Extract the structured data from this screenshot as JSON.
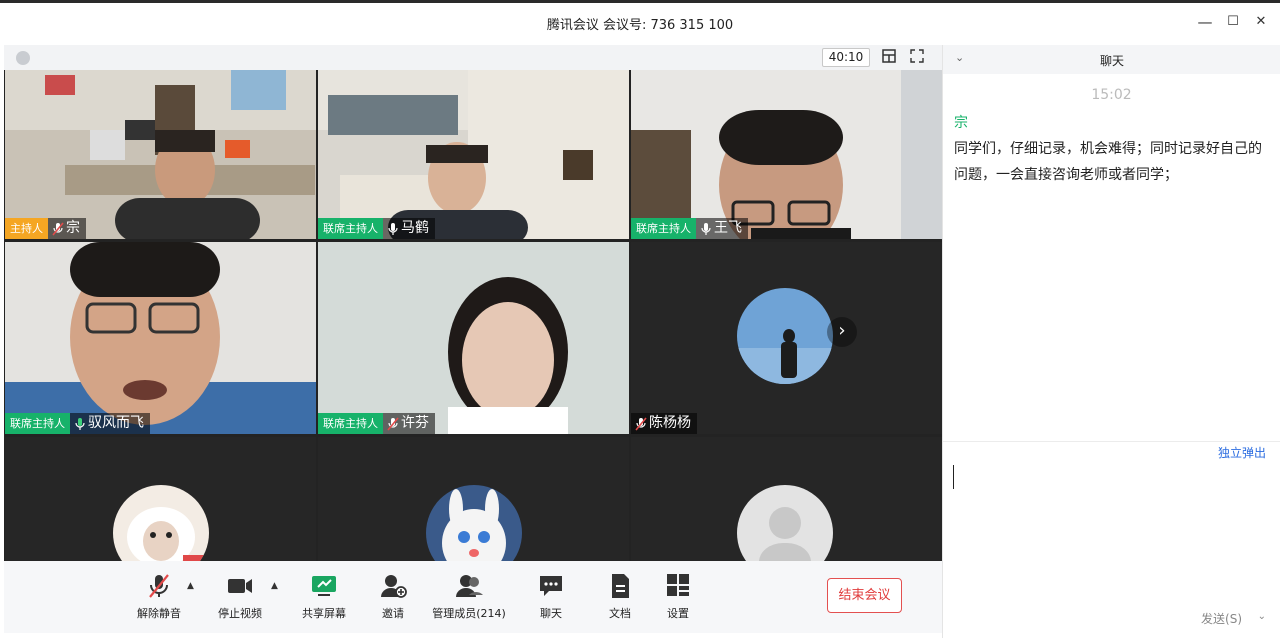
{
  "window": {
    "title": "腾讯会议 会议号: 736 315 100",
    "minimize": "—",
    "maximize": "☐",
    "close": "✕"
  },
  "video_bar": {
    "timer": "40:10",
    "layout_icon": "layout-icon",
    "fullscreen_icon": "fullscreen-icon"
  },
  "participants": [
    {
      "role": "主持人",
      "name": "宗",
      "mic": "muted"
    },
    {
      "role": "联席主持人",
      "name": "马鹤",
      "mic": "on"
    },
    {
      "role": "联席主持人",
      "name": "王飞",
      "mic": "on"
    },
    {
      "role": "联席主持人",
      "name": "驭风而飞",
      "mic": "on"
    },
    {
      "role": "联席主持人",
      "name": "许芬",
      "mic": "muted"
    },
    {
      "role": "",
      "name": "陈杨杨",
      "mic": "muted"
    },
    {
      "role": "",
      "name": "",
      "mic": ""
    },
    {
      "role": "",
      "name": "",
      "mic": ""
    },
    {
      "role": "",
      "name": "",
      "mic": ""
    }
  ],
  "toolbar": {
    "unmute": "解除静音",
    "stop_video": "停止视频",
    "share_screen": "共享屏幕",
    "invite": "邀请",
    "manage_members": "管理成员(214)",
    "chat": "聊天",
    "docs": "文档",
    "settings": "设置",
    "end_meeting": "结束会议"
  },
  "chat": {
    "title": "聊天",
    "time": "15:02",
    "sender": "宗",
    "message": "同学们，仔细记录，机会难得；同时记录好自己的问题，一会直接咨询老师或者同学；",
    "popout": "独立弹出",
    "send": "发送(S)"
  },
  "colors": {
    "host": "#f5a623",
    "cohost": "#17b26a",
    "end_button": "#e03b3b",
    "link": "#2b6ce0"
  }
}
